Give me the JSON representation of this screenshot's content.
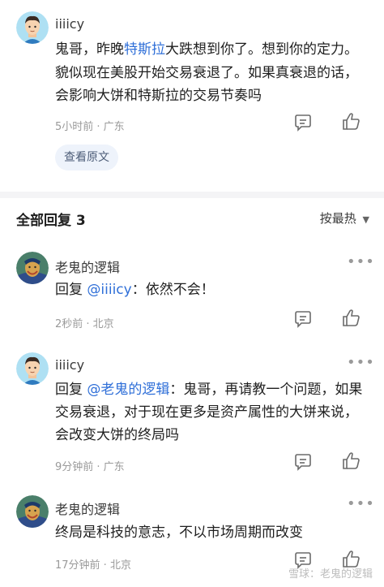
{
  "post": {
    "author": "iiiicy",
    "text_before": "鬼哥，昨晚",
    "text_link": "特斯拉",
    "text_after": "大跌想到你了。想到你的定力。",
    "line2": "貌似现在美股开始交易衰退了。如果真衰退的话，",
    "line3": "会影响大饼和特斯拉的交易节奏吗",
    "meta": "5小时前 · 广东",
    "view_original": "查看原文"
  },
  "comments_header": {
    "title": "全部回复 3",
    "sort": "按最热"
  },
  "comments": [
    {
      "author": "老鬼的逻辑",
      "reply_prefix": "回复 ",
      "mention": "@iiiicy",
      "text": "：依然不会！",
      "meta": "2秒前 · 北京"
    },
    {
      "author": "iiiicy",
      "reply_prefix": "回复 ",
      "mention": "@老鬼的逻辑",
      "text": "：鬼哥，再请教一个问题，如果",
      "line2": "交易衰退，对于现在更多是资产属性的大饼来说，",
      "line3": "会改变大饼的终局吗",
      "meta": "9分钟前 · 广东"
    },
    {
      "author": "老鬼的逻辑",
      "text": "终局是科技的意志，不以市场周期而改变",
      "meta": "17分钟前 · 北京"
    }
  ],
  "watermark": "雪球：老鬼的逻辑",
  "colors": {
    "link": "#2f6fd8",
    "meta": "#9a9a9a",
    "accent_bg": "#eef3fb"
  }
}
